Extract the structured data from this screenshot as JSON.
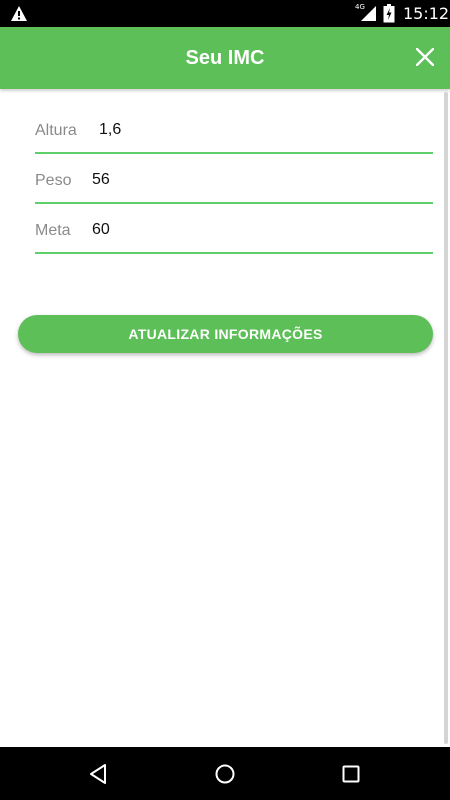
{
  "status_bar": {
    "network": "4G",
    "time": "15:12"
  },
  "app_bar": {
    "title": "Seu IMC"
  },
  "form": {
    "fields": [
      {
        "label": "Altura",
        "value": "1,6"
      },
      {
        "label": "Peso",
        "value": "56"
      },
      {
        "label": "Meta",
        "value": "60"
      }
    ]
  },
  "actions": {
    "update_label": "ATUALIZAR INFORMAÇÕES"
  },
  "colors": {
    "accent": "#5cbf57",
    "underline": "#5fcf6a",
    "label": "#8a8a8a"
  },
  "icons": {
    "status_left": "warning-icon",
    "close": "close-icon",
    "nav_back": "back-triangle-icon",
    "nav_home": "home-circle-icon",
    "nav_recent": "recents-square-icon"
  }
}
